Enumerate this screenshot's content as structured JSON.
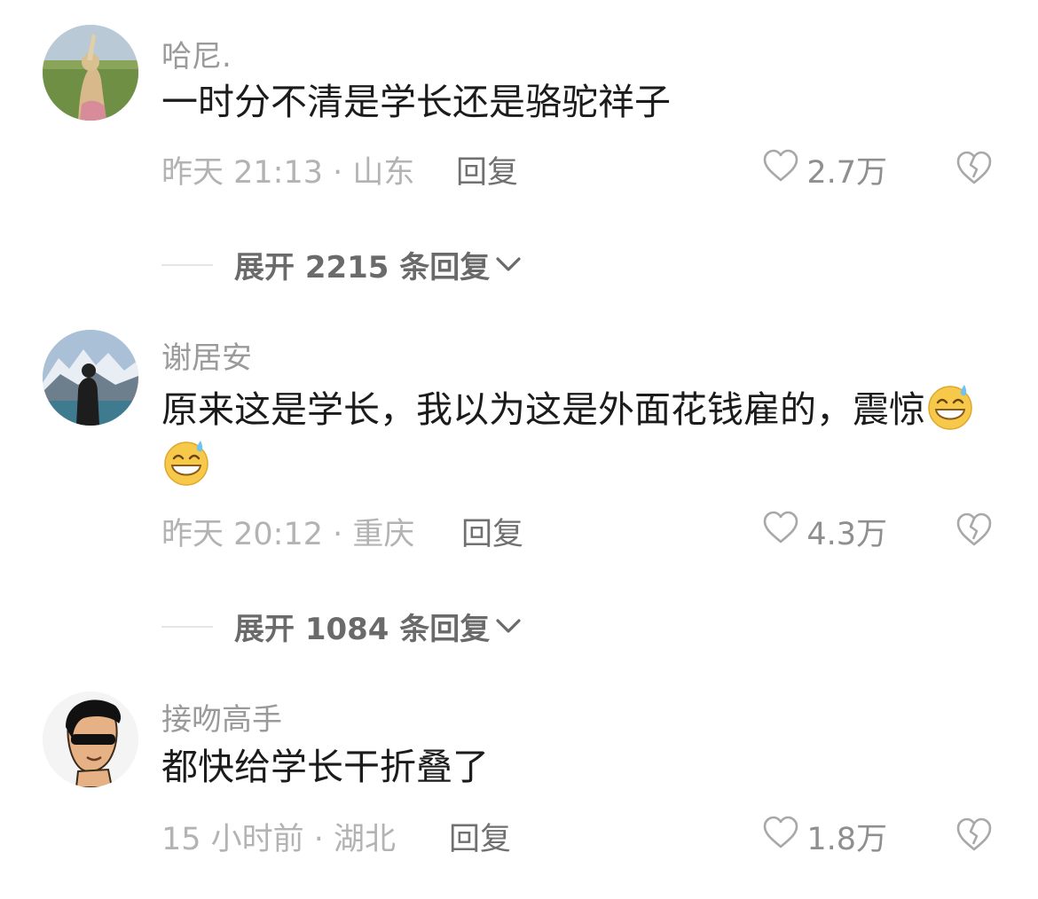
{
  "comments": [
    {
      "username": "哈尼.",
      "text": "一时分不清是学长还是骆驼祥子",
      "time_location": "昨天 21:13 · 山东",
      "reply_label": "回复",
      "likes": "2.7万",
      "expand_label": "展开 2215 条回复"
    },
    {
      "username": "谢居安",
      "text": "原来这是学长，我以为这是外面花钱雇的，震惊",
      "time_location": "昨天 20:12 · 重庆",
      "reply_label": "回复",
      "likes": "4.3万",
      "expand_label": "展开 1084 条回复"
    },
    {
      "username": "接吻高手",
      "text": "都快给学长干折叠了",
      "time_location": "15 小时前 · 湖北",
      "reply_label": "回复",
      "likes": "1.8万"
    }
  ],
  "icons": {
    "like": "heart-outline-icon",
    "dislike": "broken-heart-icon",
    "expand": "chevron-down-icon",
    "emoji": "grinning-sweat-emoji-icon"
  },
  "colors": {
    "text": "#1b1b1b",
    "meta": "#b3b3b3",
    "username": "#9a9a9a"
  }
}
